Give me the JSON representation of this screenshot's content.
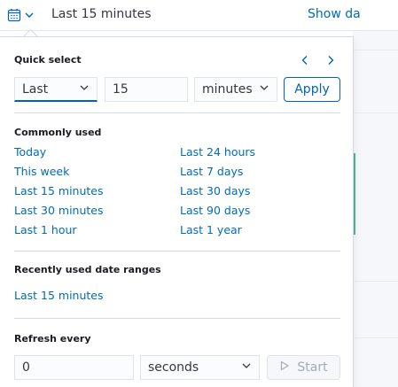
{
  "top_bar": {
    "range_label": "Last 15 minutes",
    "show_dates_label": "Show da"
  },
  "quick_select": {
    "title": "Quick select",
    "direction": "Last",
    "amount": "15",
    "unit": "minutes",
    "apply_label": "Apply"
  },
  "commonly_used": {
    "title": "Commonly used",
    "items": [
      "Today",
      "Last 24 hours",
      "This week",
      "Last 7 days",
      "Last 15 minutes",
      "Last 30 days",
      "Last 30 minutes",
      "Last 90 days",
      "Last 1 hour",
      "Last 1 year"
    ]
  },
  "recently_used": {
    "title": "Recently used date ranges",
    "items": [
      "Last 15 minutes"
    ]
  },
  "refresh": {
    "title": "Refresh every",
    "interval": "0",
    "unit": "seconds",
    "start_label": "Start"
  },
  "colors": {
    "link": "#006bb8",
    "primary": "#0061c2",
    "text": "#343741",
    "border": "#d3dae6",
    "disabled": "#a2abba",
    "status_green": "#54b399"
  },
  "icons": {
    "date_picker": "calendar-icon",
    "picker_toggle": "chevron-down-icon",
    "previous": "chevron-left-icon",
    "next": "chevron-right-icon",
    "select_caret": "chevron-down-icon",
    "start": "play-icon"
  }
}
